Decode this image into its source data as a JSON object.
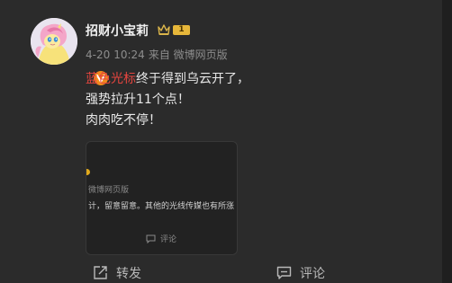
{
  "post": {
    "author": {
      "name": "招财小宝莉",
      "level": "1"
    },
    "meta": {
      "date": "4-20",
      "time": "10:24",
      "source": "来自 微博网页版"
    },
    "content": {
      "highlight": "蓝色光标",
      "line1_rest": "终于得到乌云开了，",
      "line2": "强势拉升11个点！",
      "line3": "肉肉吃不停！"
    },
    "embed": {
      "source": "微博网页版",
      "text": "计，留意留意。其他的光线传媒也有所涨",
      "comment_label": "评论"
    },
    "actions": {
      "repost_label": "转发",
      "comment_label": "评论"
    },
    "colors": {
      "highlight": "#e6453f",
      "verify_badge": "#f18a1c",
      "level_badge": "#e7b73a",
      "background": "#2b2b2b"
    }
  }
}
